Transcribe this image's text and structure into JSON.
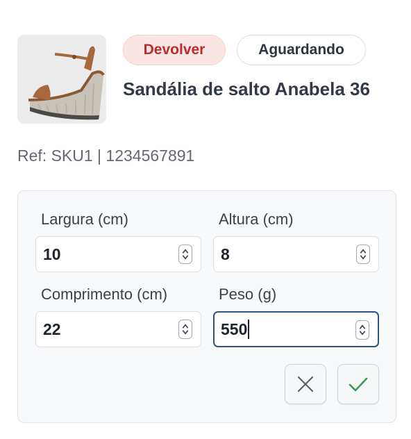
{
  "product": {
    "image_icon": "wedge-sandal-image",
    "status_badge": "Devolver",
    "tracking_badge": "Aguardando",
    "title": "Sandália de salto Anabela 36",
    "reference": "Ref: SKU1 | 1234567891"
  },
  "dimensions_form": {
    "width_label": "Largura (cm)",
    "width_value": "10",
    "height_label": "Altura (cm)",
    "height_value": "8",
    "length_label": "Comprimento (cm)",
    "length_value": "22",
    "weight_label": "Peso (g)",
    "weight_value": "550",
    "cancel_icon": "close-icon",
    "confirm_icon": "check-icon"
  },
  "colors": {
    "status_red": "#b82d2d",
    "status_red_bg": "#fbe4e4",
    "focus_border": "#2d5387",
    "confirm_green": "#3a9a4f"
  }
}
